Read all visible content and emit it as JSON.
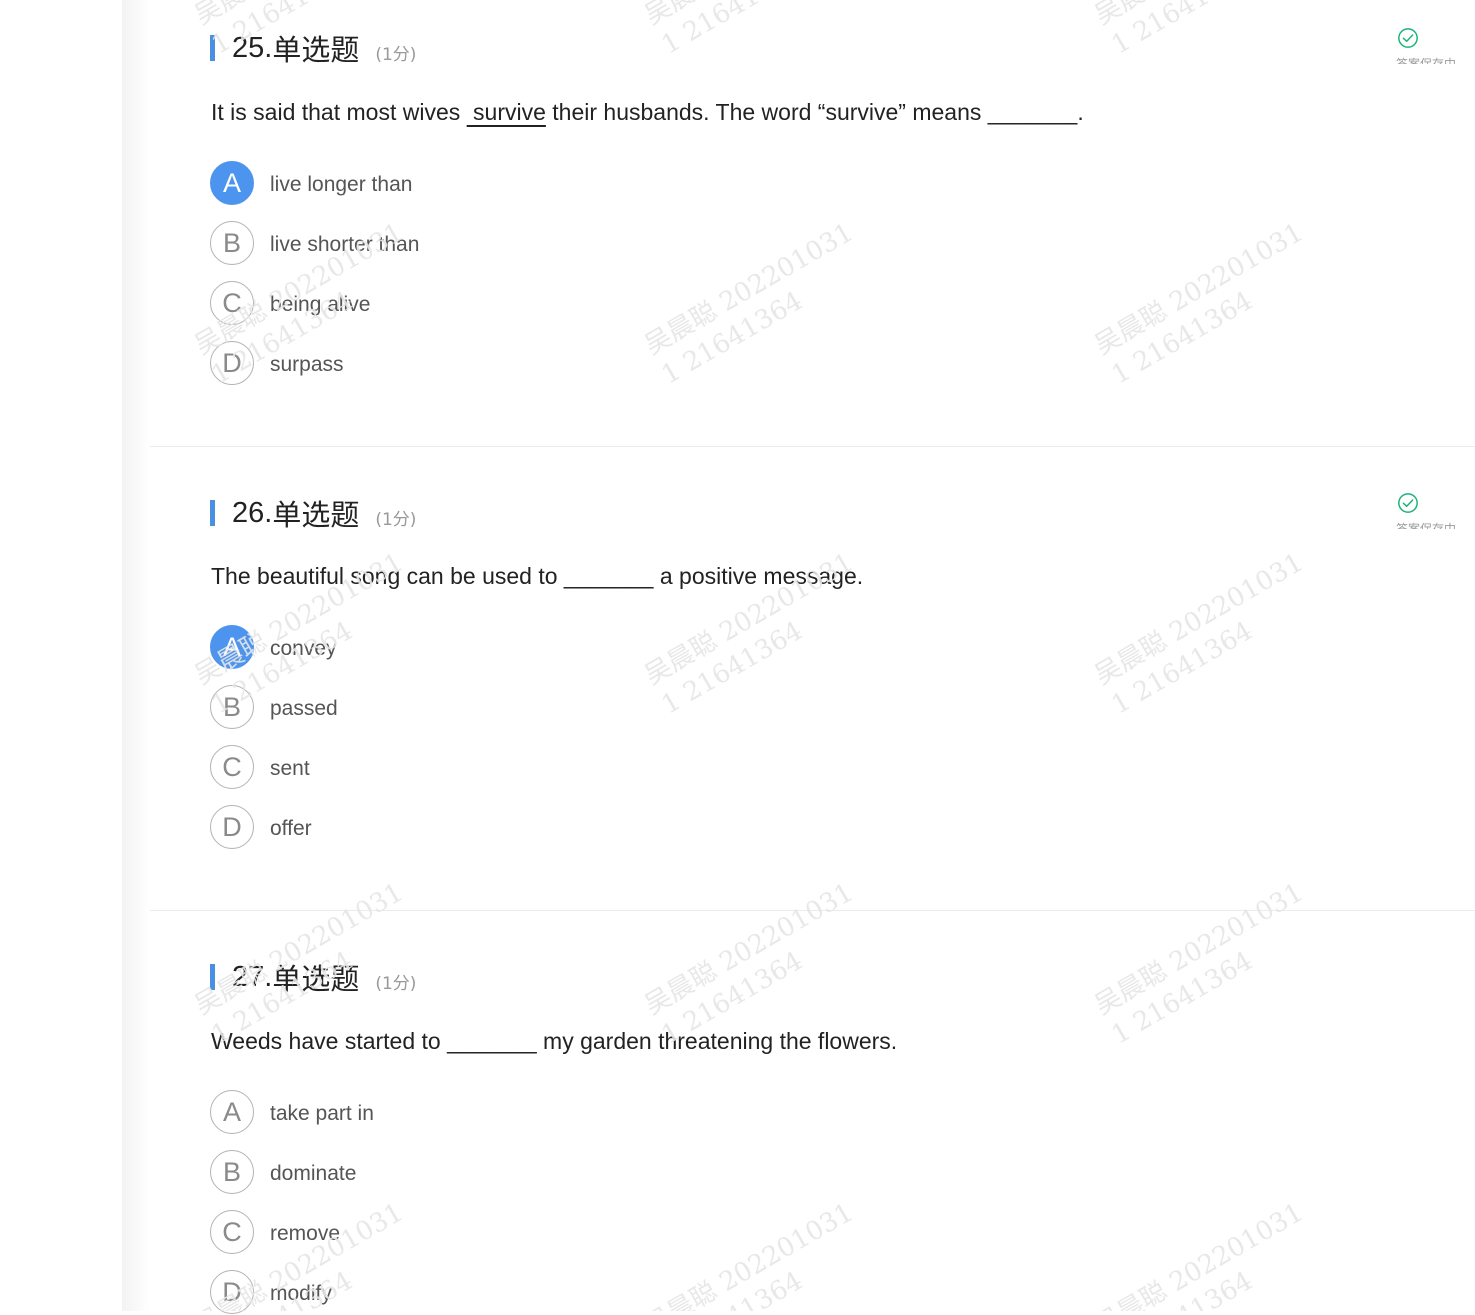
{
  "watermark": {
    "line1": "吴晨聪 202201031",
    "line2": "1 21641364"
  },
  "status": {
    "label": "答案保存中"
  },
  "questions": [
    {
      "number": "25.",
      "type": "单选题",
      "score": "(1分)",
      "stem_before": "It is said that most wives ",
      "stem_underlined": " survive",
      "stem_after": " their husbands. The word “survive” means _______.",
      "selected": "A",
      "options": [
        {
          "letter": "A",
          "text": "live longer than"
        },
        {
          "letter": "B",
          "text": "live shorter than"
        },
        {
          "letter": "C",
          "text": "being alive"
        },
        {
          "letter": "D",
          "text": "surpass"
        }
      ]
    },
    {
      "number": "26.",
      "type": "单选题",
      "score": "(1分)",
      "stem_before": "The beautiful song can be used to _______ a positive message.",
      "stem_underlined": "",
      "stem_after": "",
      "selected": "A",
      "options": [
        {
          "letter": "A",
          "text": "convey"
        },
        {
          "letter": "B",
          "text": "passed"
        },
        {
          "letter": "C",
          "text": "sent"
        },
        {
          "letter": "D",
          "text": "offer"
        }
      ]
    },
    {
      "number": "27.",
      "type": "单选题",
      "score": "(1分)",
      "stem_before": "Weeds have started to _______ my garden threatening the flowers.",
      "stem_underlined": "",
      "stem_after": "",
      "selected": "",
      "options": [
        {
          "letter": "A",
          "text": "take part in"
        },
        {
          "letter": "B",
          "text": "dominate"
        },
        {
          "letter": "C",
          "text": "remove"
        },
        {
          "letter": "D",
          "text": "modify"
        }
      ]
    }
  ],
  "colors": {
    "accent": "#4a90e2",
    "selected_option": "#4d94ee",
    "status_check": "#19b37a"
  },
  "icons": {
    "status": "check-circle-icon"
  }
}
